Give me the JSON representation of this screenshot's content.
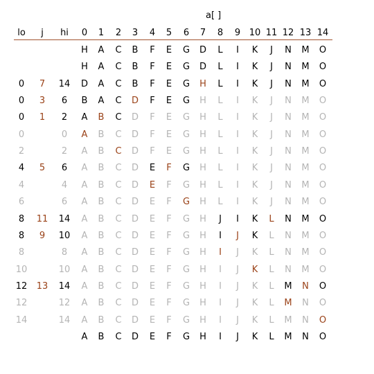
{
  "array_label": "a[ ]",
  "headers": {
    "lo": "lo",
    "j": "j",
    "hi": "hi",
    "indices": [
      "0",
      "1",
      "2",
      "3",
      "4",
      "5",
      "6",
      "7",
      "8",
      "9",
      "10",
      "11",
      "12",
      "13",
      "14"
    ]
  },
  "colors": {
    "black": "#000000",
    "highlight": "#9a4218",
    "grey": "#b4b4b4",
    "rule": "#a0522d"
  },
  "rows": [
    {
      "lo": "",
      "j": "",
      "hi": "",
      "letters": "HACBFEGDLIKJNMO",
      "shade": "kkkkkkkkkkkkkkk",
      "idx": "kkk"
    },
    {
      "lo": "",
      "j": "",
      "hi": "",
      "letters": "HACBFEGDLIKJNMO",
      "shade": "kkkkkkkkkkkkkkk",
      "idx": "kkk"
    },
    {
      "lo": "0",
      "j": "7",
      "hi": "14",
      "letters": "DACBFEGHLIKJNMO",
      "shade": "kkkkkkkrkkkkkkk",
      "idx": "krk"
    },
    {
      "lo": "0",
      "j": "3",
      "hi": "6",
      "letters": "BACDFEGHLIKJNMO",
      "shade": "kkkrkkkgggggggg",
      "idx": "krk"
    },
    {
      "lo": "0",
      "j": "1",
      "hi": "2",
      "letters": "ABCDFEGHLIKJNMO",
      "shade": "krkgggggggggggg",
      "idx": "krk"
    },
    {
      "lo": "0",
      "j": "",
      "hi": "0",
      "letters": "ABCDFEGHLIKJNMO",
      "shade": "rgggggggggggggg",
      "idx": "ggg"
    },
    {
      "lo": "2",
      "j": "",
      "hi": "2",
      "letters": "ABCDFEGHLIKJNMO",
      "shade": "ggrgggggggggggg",
      "idx": "ggg"
    },
    {
      "lo": "4",
      "j": "5",
      "hi": "6",
      "letters": "ABCDEFGHLIKJNMO",
      "shade": "ggggkrkgggggggg",
      "idx": "krk"
    },
    {
      "lo": "4",
      "j": "",
      "hi": "4",
      "letters": "ABCDEFGHLIKJNMO",
      "shade": "ggggrgggggggggg",
      "idx": "ggg"
    },
    {
      "lo": "6",
      "j": "",
      "hi": "6",
      "letters": "ABCDEFGHLIKJNMO",
      "shade": "ggggggrgggggggg",
      "idx": "ggg"
    },
    {
      "lo": "8",
      "j": "11",
      "hi": "14",
      "letters": "ABCDEFGHJIKLNMO",
      "shade": "ggggggggkkkrkkk",
      "idx": "krk"
    },
    {
      "lo": "8",
      "j": "9",
      "hi": "10",
      "letters": "ABCDEFGHIJKLNMO",
      "shade": "ggggggggkrkgggg",
      "idx": "krk"
    },
    {
      "lo": "8",
      "j": "",
      "hi": "8",
      "letters": "ABCDEFGHIJKLNMO",
      "shade": "ggggggggrgggggg",
      "idx": "ggg"
    },
    {
      "lo": "10",
      "j": "",
      "hi": "10",
      "letters": "ABCDEFGHIJKLNMO",
      "shade": "ggggggggggrgggg",
      "idx": "ggg"
    },
    {
      "lo": "12",
      "j": "13",
      "hi": "14",
      "letters": "ABCDEFGHIJKLMNO",
      "shade": "ggggggggggggkrk",
      "idx": "krk"
    },
    {
      "lo": "12",
      "j": "",
      "hi": "12",
      "letters": "ABCDEFGHIJKLMNO",
      "shade": "ggggggggggggrgg",
      "idx": "ggg"
    },
    {
      "lo": "14",
      "j": "",
      "hi": "14",
      "letters": "ABCDEFGHIJKLMNO",
      "shade": "ggggggggggggggr",
      "idx": "ggg"
    },
    {
      "lo": "",
      "j": "",
      "hi": "",
      "letters": "ABCDEFGHIJKLMNO",
      "shade": "kkkkkkkkkkkkkkk",
      "idx": "kkk"
    }
  ]
}
